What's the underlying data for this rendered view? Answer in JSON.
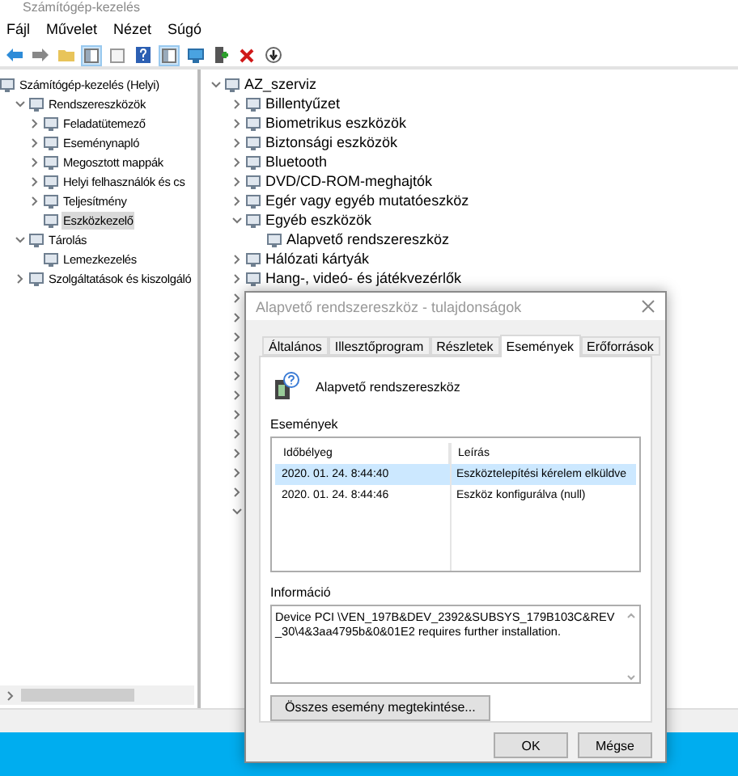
{
  "window": {
    "title": "Számítógép-kezelés"
  },
  "menu": [
    "Fájl",
    "Művelet",
    "Nézet",
    "Súgó"
  ],
  "toolbar": [
    {
      "kind": "back",
      "pressed": false
    },
    {
      "kind": "forward",
      "pressed": false
    },
    {
      "kind": "folder",
      "pressed": false
    },
    {
      "kind": "pane",
      "pressed": true
    },
    {
      "kind": "sheet",
      "pressed": false
    },
    {
      "kind": "help",
      "pressed": false
    },
    {
      "kind": "pane",
      "pressed": true
    },
    {
      "kind": "monitor",
      "pressed": false
    },
    {
      "kind": "add",
      "pressed": false
    },
    {
      "kind": "delete",
      "pressed": false
    },
    {
      "kind": "download",
      "pressed": false
    }
  ],
  "nav_tree": [
    {
      "label": "Számítógép-kezelés (Helyi)",
      "selected": false,
      "children": [
        {
          "label": "Rendszereszközök",
          "expanded": true,
          "selected": false,
          "children": [
            {
              "label": "Feladatütemező",
              "expanded": false,
              "selected": false
            },
            {
              "label": "Eseménynapló",
              "expanded": false,
              "selected": false
            },
            {
              "label": "Megosztott mappák",
              "expanded": false,
              "selected": false
            },
            {
              "label": "Helyi felhasználók és cs",
              "expanded": false,
              "selected": false
            },
            {
              "label": "Teljesítmény",
              "expanded": false,
              "selected": false
            },
            {
              "label": "Eszközkezelő",
              "selected": true
            }
          ]
        },
        {
          "label": "Tárolás",
          "expanded": true,
          "selected": false,
          "children": [
            {
              "label": "Lemezkezelés",
              "selected": false
            }
          ]
        },
        {
          "label": "Szolgáltatások és kiszolgáló",
          "expanded": false,
          "selected": false
        }
      ]
    }
  ],
  "device_tree": [
    {
      "label": "AZ_szerviz",
      "expanded": true,
      "children": [
        {
          "label": "Billentyűzet",
          "expanded": false
        },
        {
          "label": "Biometrikus eszközök",
          "expanded": false
        },
        {
          "label": "Biztonsági eszközök",
          "expanded": false
        },
        {
          "label": "Bluetooth",
          "expanded": false
        },
        {
          "label": "DVD/CD-ROM-meghajtók",
          "expanded": false
        },
        {
          "label": "Egér vagy egyéb mutatóeszköz",
          "expanded": false
        },
        {
          "label": "Egyéb eszközök",
          "expanded": true,
          "children": [
            {
              "label": "Alapvető rendszereszköz"
            }
          ]
        },
        {
          "label": "Hálózati kártyák",
          "expanded": false
        },
        {
          "label": "Hang-, videó- és játékvezérlők",
          "expanded": false
        }
      ]
    }
  ],
  "covered_rows": [
    {
      "expanded": false
    },
    {
      "expanded": false
    },
    {
      "expanded": false
    },
    {
      "expanded": false
    },
    {
      "expanded": false
    },
    {
      "expanded": false
    },
    {
      "expanded": false
    },
    {
      "expanded": false
    },
    {
      "expanded": false
    },
    {
      "expanded": false
    },
    {
      "expanded": false
    },
    {
      "expanded": true
    }
  ],
  "dialog": {
    "title": "Alapvető rendszereszköz - tulajdonságok",
    "tabs": [
      {
        "label": "Általános",
        "selected": false
      },
      {
        "label": "Illesztőprogram",
        "selected": false
      },
      {
        "label": "Részletek",
        "selected": false
      },
      {
        "label": "Események",
        "selected": true
      },
      {
        "label": "Erőforrások",
        "selected": false
      }
    ],
    "device_name": "Alapvető rendszereszköz",
    "events_label": "Események",
    "columns": [
      "Időbélyeg",
      "Leírás"
    ],
    "rows": [
      {
        "time": "2020. 01. 24. 8:44:40",
        "description": "Eszköztelepítési kérelem elküldve",
        "selected": true
      },
      {
        "time": "2020. 01. 24. 8:44:46",
        "description": "Eszköz konfigurálva (null)",
        "selected": false
      }
    ],
    "info_label": "Információ",
    "info_text": "Device PCI \\VEN_197B&DEV_2392&SUBSYS_179B103C&REV_30\\4&3aa4795b&0&01E2 requires further installation.",
    "all_events_button": "Összes esemény megtekintése...",
    "buttons": [
      "OK",
      "Mégse"
    ]
  }
}
